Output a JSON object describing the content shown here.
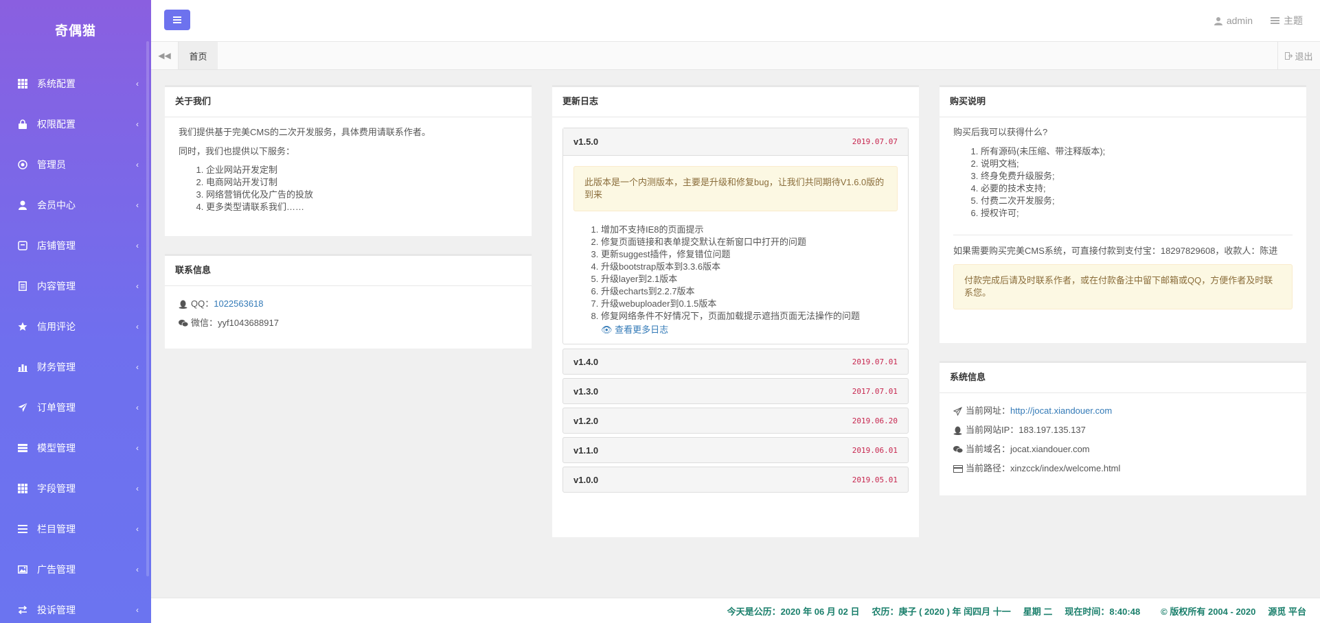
{
  "brand": "奇偶猫",
  "sidebar": {
    "items": [
      {
        "label": "系统配置",
        "icon": "grid-icon"
      },
      {
        "label": "权限配置",
        "icon": "lock-icon"
      },
      {
        "label": "管理员",
        "icon": "target-icon"
      },
      {
        "label": "会员中心",
        "icon": "user-icon"
      },
      {
        "label": "店铺管理",
        "icon": "store-icon"
      },
      {
        "label": "内容管理",
        "icon": "document-icon"
      },
      {
        "label": "信用评论",
        "icon": "star-icon"
      },
      {
        "label": "财务管理",
        "icon": "bar-chart-icon"
      },
      {
        "label": "订单管理",
        "icon": "send-icon"
      },
      {
        "label": "模型管理",
        "icon": "stack-icon"
      },
      {
        "label": "字段管理",
        "icon": "grid-icon"
      },
      {
        "label": "栏目管理",
        "icon": "list-icon"
      },
      {
        "label": "广告管理",
        "icon": "image-icon"
      },
      {
        "label": "投诉管理",
        "icon": "exchange-icon"
      }
    ]
  },
  "header": {
    "user": "admin",
    "theme": "主题"
  },
  "tabs": {
    "home": "首页",
    "logout": "退出"
  },
  "about": {
    "title": "关于我们",
    "intro": "我们提供基于完美CMS的二次开发服务，具体费用请联系作者。",
    "also": "同时，我们也提供以下服务：",
    "services": [
      "企业网站开发定制",
      "电商网站开发订制",
      "网络营销优化及广告的投放",
      "更多类型请联系我们……"
    ]
  },
  "contact": {
    "title": "联系信息",
    "qq_label": "QQ：",
    "qq": "1022563618",
    "wechat_label": "微信：",
    "wechat": "yyf1043688917"
  },
  "changelog": {
    "title": "更新日志",
    "open": {
      "version": "v1.5.0",
      "date": "2019.07.07",
      "notice": "此版本是一个内测版本，主要是升级和修复bug，让我们共同期待V1.6.0版的到来",
      "items": [
        "增加不支持IE8的页面提示",
        "修复页面链接和表单提交默认在新窗口中打开的问题",
        "更新suggest插件，修复错位问题",
        "升级bootstrap版本到3.3.6版本",
        "升级layer到2.1版本",
        "升级echarts到2.2.7版本",
        "升级webuploader到0.1.5版本",
        "修复网络条件不好情况下，页面加载提示遮挡页面无法操作的问题"
      ],
      "more": "查看更多日志"
    },
    "versions": [
      {
        "version": "v1.4.0",
        "date": "2019.07.01"
      },
      {
        "version": "v1.3.0",
        "date": "2017.07.01"
      },
      {
        "version": "v1.2.0",
        "date": "2019.06.20"
      },
      {
        "version": "v1.1.0",
        "date": "2019.06.01"
      },
      {
        "version": "v1.0.0",
        "date": "2019.05.01"
      }
    ]
  },
  "purchase": {
    "title": "购买说明",
    "question": "购买后我可以获得什么?",
    "items": [
      "所有源码(未压缩、带注释版本);",
      "说明文档;",
      "终身免费升级服务;",
      "必要的技术支持;",
      "付费二次开发服务;",
      "授权许可;"
    ],
    "pay": "如果需要购买完美CMS系统，可直接付款到支付宝：18297829608，收款人：陈进",
    "notice": "付款完成后请及时联系作者，或在付款备注中留下邮箱或QQ，方便作者及时联系您。"
  },
  "sysinfo": {
    "title": "系统信息",
    "url_label": "当前网址：",
    "url": "http://jocat.xiandouer.com",
    "ip_label": "当前网站IP：",
    "ip": "183.197.135.137",
    "domain_label": "当前域名：",
    "domain": "jocat.xiandouer.com",
    "path_label": "当前路径：",
    "path": "xinzcck/index/welcome.html"
  },
  "footer": {
    "date": "今天是公历：2020 年 06 月 02 日",
    "lunar": "农历：庚子 ( 2020 ) 年  闰四月 十一",
    "weekday": "星期 二",
    "time": "现在时间：8:40:48",
    "copyright": "© 版权所有 2004 - 2020",
    "platform": "源觅 平台"
  }
}
